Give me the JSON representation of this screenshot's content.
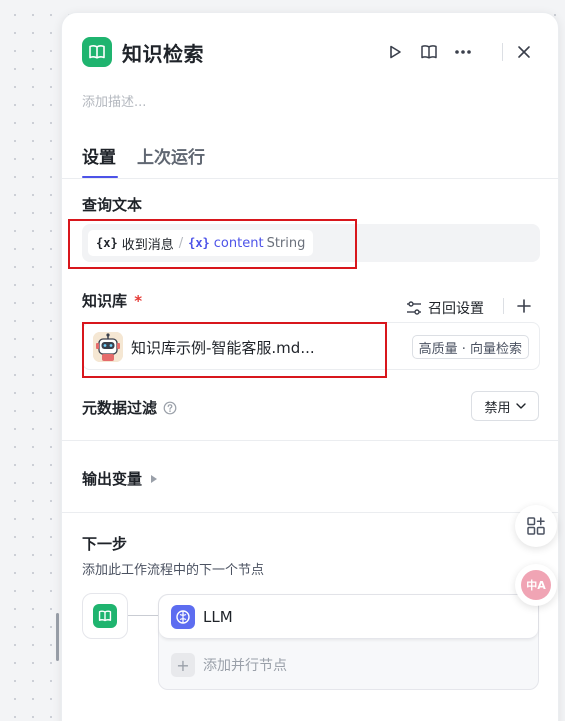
{
  "header": {
    "title": "知识检索",
    "description_placeholder": "添加描述..."
  },
  "tabs": [
    {
      "label": "设置",
      "active": true
    },
    {
      "label": "上次运行",
      "active": false
    }
  ],
  "query": {
    "label": "查询文本",
    "chip_symbol": "{x}",
    "source": "收到消息",
    "separator": "/",
    "variable": "content",
    "type": "String"
  },
  "knowledge": {
    "label": "知识库",
    "required_mark": "*",
    "recall_label": "召回设置",
    "item_name": "知识库示例-智能客服.md...",
    "item_tag": "高质量 · 向量检索"
  },
  "metadata_filter": {
    "label": "元数据过滤",
    "select_value": "禁用"
  },
  "output": {
    "label": "输出变量"
  },
  "next_step": {
    "label": "下一步",
    "subtitle": "添加此工作流程中的下一个节点",
    "node_label": "LLM",
    "add_parallel": "添加并行节点",
    "add_symbol": "+"
  },
  "floating": {
    "translate_badge": "中A"
  },
  "colors": {
    "accent": "#4d53e8",
    "node_green": "#1fb46f",
    "highlight_red": "#d8161c",
    "required_red": "#e53935"
  }
}
